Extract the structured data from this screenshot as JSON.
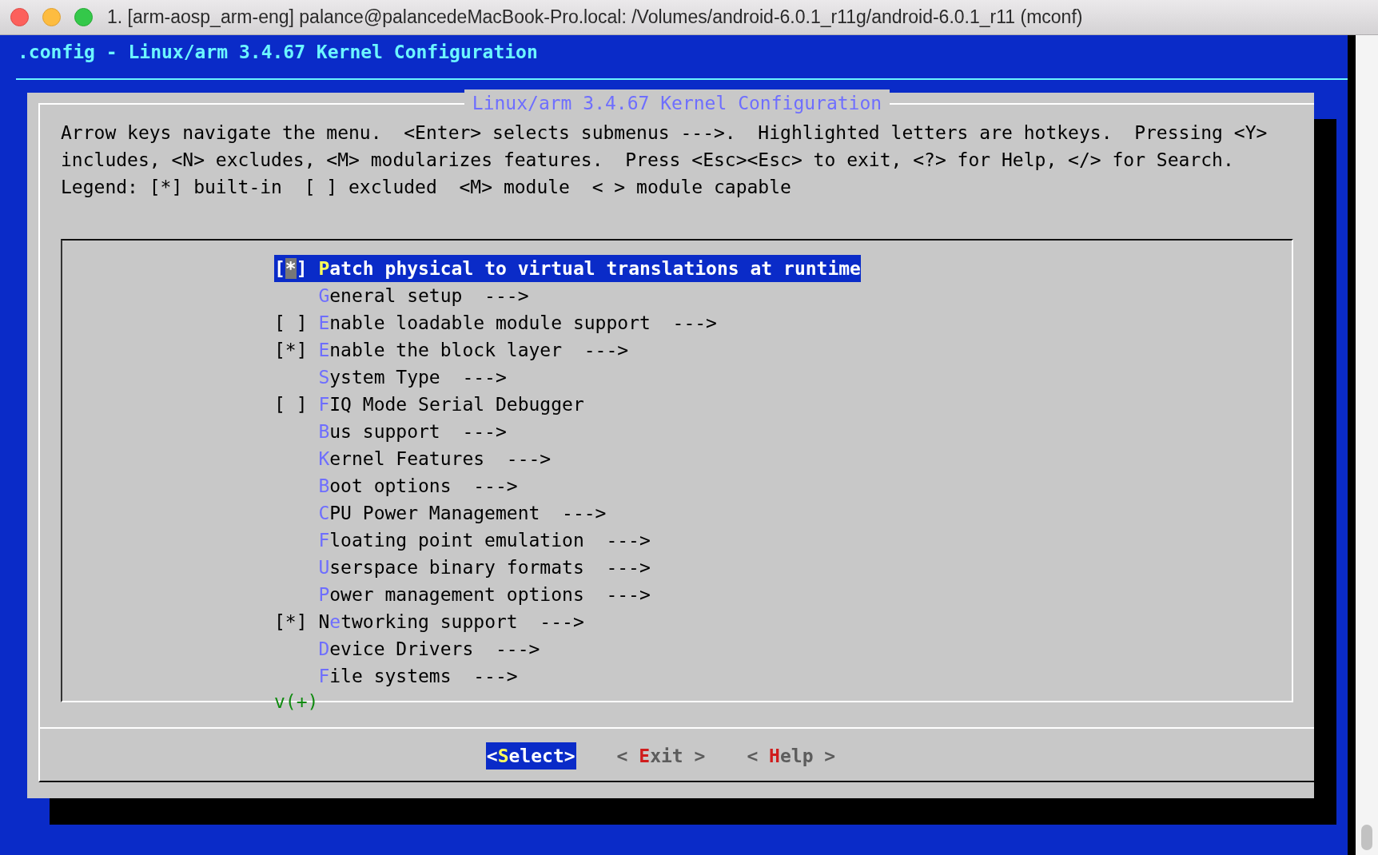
{
  "window": {
    "title": "1. [arm-aosp_arm-eng] palance@palancedeMacBook-Pro.local: /Volumes/android-6.0.1_r11g/android-6.0.1_r11 (mconf)"
  },
  "terminal": {
    "header": ".config - Linux/arm 3.4.67 Kernel Configuration"
  },
  "dialog": {
    "title": "Linux/arm 3.4.67 Kernel Configuration",
    "intro_lines": [
      "Arrow keys navigate the menu.  <Enter> selects submenus --->.  Highlighted letters are hotkeys.  Pressing <Y>",
      "includes, <N> excludes, <M> modularizes features.  Press <Esc><Esc> to exit, <?> for Help, </> for Search."
    ],
    "legend": "Legend: [*] built-in  [ ] excluded  <M> module  < > module capable",
    "menu": {
      "items": [
        {
          "kind": "checkbox",
          "box": "[*]",
          "label": "**P**atch physical to virtual translations at runtime",
          "selected": true
        },
        {
          "kind": "submenu",
          "label": "**G**eneral setup  --->",
          "selected": false
        },
        {
          "kind": "checkbox",
          "box": "[ ]",
          "label": "**E**nable loadable module support  --->",
          "selected": false
        },
        {
          "kind": "checkbox",
          "box": "[*]",
          "label": "**E**nable the block layer  --->",
          "selected": false
        },
        {
          "kind": "submenu",
          "label": "**S**ystem Type  --->",
          "selected": false
        },
        {
          "kind": "checkbox",
          "box": "[ ]",
          "label": "**F**IQ Mode Serial Debugger",
          "selected": false
        },
        {
          "kind": "submenu",
          "label": "**B**us support  --->",
          "selected": false
        },
        {
          "kind": "submenu",
          "label": "**K**ernel Features  --->",
          "selected": false
        },
        {
          "kind": "submenu",
          "label": "**B**oot options  --->",
          "selected": false
        },
        {
          "kind": "submenu",
          "label": "**C**PU Power Management  --->",
          "selected": false
        },
        {
          "kind": "submenu",
          "label": "**F**loating point emulation  --->",
          "selected": false
        },
        {
          "kind": "submenu",
          "label": "**U**serspace binary formats  --->",
          "selected": false
        },
        {
          "kind": "submenu",
          "label": "**P**ower management options  --->",
          "selected": false
        },
        {
          "kind": "checkbox",
          "box": "[*]",
          "label": "N**e**tworking support  --->",
          "selected": false
        },
        {
          "kind": "submenu",
          "label": "**D**evice Drivers  --->",
          "selected": false
        },
        {
          "kind": "submenu",
          "label": "**F**ile systems  --->",
          "selected": false
        }
      ],
      "more_indicator": "v(+)"
    },
    "buttons": [
      {
        "label": "<**S**elect>",
        "selected": true
      },
      {
        "label": "< **E**xit >",
        "selected": false
      },
      {
        "label": "< **H**elp >",
        "selected": false
      }
    ]
  }
}
